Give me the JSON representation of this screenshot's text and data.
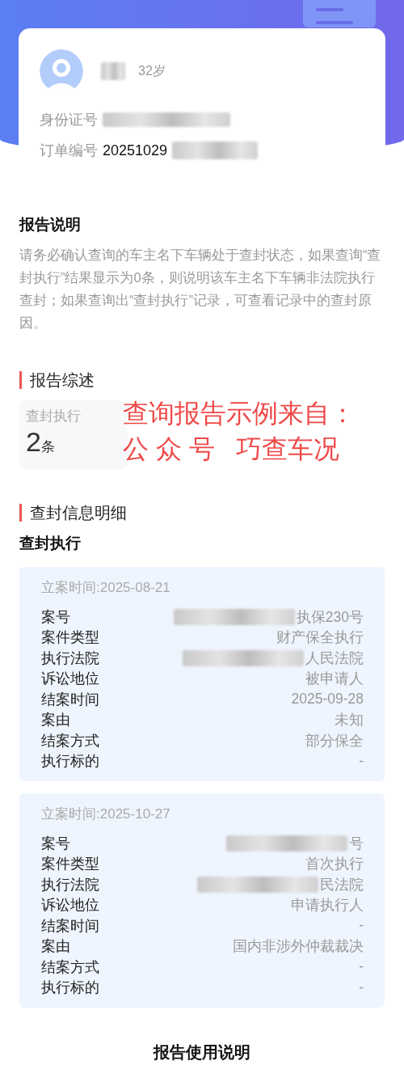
{
  "profile": {
    "name_redacted": true,
    "age": "32岁",
    "fields": [
      {
        "label": "身份证号",
        "redacted": true
      },
      {
        "label": "订单编号",
        "value": "20251029",
        "redacted": true
      }
    ]
  },
  "report_note": {
    "title": "报告说明",
    "text": "请务必确认查询的车主名下车辆处于查封状态，如果查询“查封执行”结果显示为0条，则说明该车主名下车辆非法院执行查封；如果查询出“查封执行”记录，可查看记录中的查封原因。"
  },
  "summary": {
    "title": "报告综述",
    "tiles": [
      {
        "label": "查封执行",
        "count": "2",
        "unit": "条"
      }
    ]
  },
  "overlay_note": {
    "lines": [
      "查询报告示例来自：",
      "公 众 号   巧查车况"
    ]
  },
  "details": {
    "title": "查封信息明细",
    "subtitle": "查封执行",
    "cards": [
      {
        "filed": "立案时间:2025-08-21",
        "rows": [
          {
            "label": "案号",
            "value": "执保230号",
            "redacted": true
          },
          {
            "label": "案件类型",
            "value": "财产保全执行",
            "redacted": false
          },
          {
            "label": "执行法院",
            "value": "人民法院",
            "redacted": true
          },
          {
            "label": "诉讼地位",
            "value": "被申请人",
            "redacted": false
          },
          {
            "label": "结案时间",
            "value": "2025-09-28",
            "redacted": false
          },
          {
            "label": "案由",
            "value": "未知",
            "redacted": false
          },
          {
            "label": "结案方式",
            "value": "部分保全",
            "redacted": false
          },
          {
            "label": "执行标的",
            "value": "-",
            "redacted": false
          }
        ]
      },
      {
        "filed": "立案时间:2025-10-27",
        "rows": [
          {
            "label": "案号",
            "value": "号",
            "redacted": true
          },
          {
            "label": "案件类型",
            "value": "首次执行",
            "redacted": false
          },
          {
            "label": "执行法院",
            "value": "民法院",
            "redacted": true
          },
          {
            "label": "诉讼地位",
            "value": "申请执行人",
            "redacted": false
          },
          {
            "label": "结案时间",
            "value": "-",
            "redacted": false
          },
          {
            "label": "案由",
            "value": "国内非涉外仲裁裁决",
            "redacted": false
          },
          {
            "label": "结案方式",
            "value": "-",
            "redacted": false
          },
          {
            "label": "执行标的",
            "value": "-",
            "redacted": false
          }
        ]
      }
    ]
  },
  "usage": {
    "title": "报告使用说明"
  }
}
